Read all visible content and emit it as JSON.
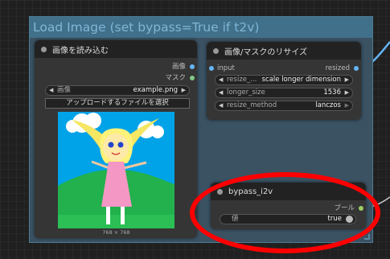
{
  "group": {
    "title": "Load Image (set bypass=True if t2v)"
  },
  "load_image_node": {
    "title": "画像を読み込む",
    "outputs": [
      "画像",
      "マスク"
    ],
    "image_widget": {
      "label": "画像",
      "value": "example.png"
    },
    "upload_button": "アップロードするファイルを選択",
    "image_size_caption": "768 × 768"
  },
  "resize_node": {
    "title": "画像/マスクのリサイズ",
    "input_label": "input",
    "output_label": "resized",
    "widgets": [
      {
        "label": "resize_...",
        "value": "scale longer dimension"
      },
      {
        "label": "longer_size",
        "value": "1536"
      },
      {
        "label": "resize_method",
        "value": "lanczos"
      }
    ]
  },
  "bypass_node": {
    "title": "bypass_i2v",
    "output_label": "ブール",
    "widget": {
      "label": "値",
      "value": "true"
    }
  },
  "colors": {
    "image_port": "#64b5f6",
    "mask_port": "#81c784",
    "bool_port": "#9ccc65",
    "wire": "#64b5f6",
    "highlight": "#ff0000"
  }
}
